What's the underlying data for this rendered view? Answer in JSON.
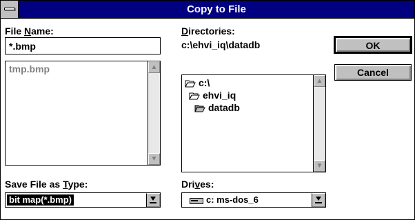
{
  "window": {
    "title": "Copy to File"
  },
  "file_name": {
    "label_pre": "File ",
    "label_key": "N",
    "label_post": "ame:",
    "value": "*.bmp",
    "list": [
      "tmp.bmp"
    ]
  },
  "directories": {
    "label_key": "D",
    "label_post": "irectories:",
    "current_path": "c:\\ehvi_iq\\datadb",
    "tree": [
      {
        "label": "c:\\",
        "icon": "open-folder-icon"
      },
      {
        "label": "ehvi_iq",
        "icon": "open-folder-icon"
      },
      {
        "label": "datadb",
        "icon": "open-folder-icon"
      }
    ]
  },
  "save_type": {
    "label_pre": "Save File as ",
    "label_key": "T",
    "label_post": "ype:",
    "value": "bit map(*.bmp)"
  },
  "drives": {
    "label_pre": "Dri",
    "label_key": "v",
    "label_post": "es:",
    "value": "c: ms-dos_6",
    "icon": "drive-icon"
  },
  "buttons": {
    "ok": "OK",
    "cancel": "Cancel"
  },
  "colors": {
    "titlebar": "#000080",
    "face": "#c0c0c0",
    "disabled_text": "#808080"
  }
}
